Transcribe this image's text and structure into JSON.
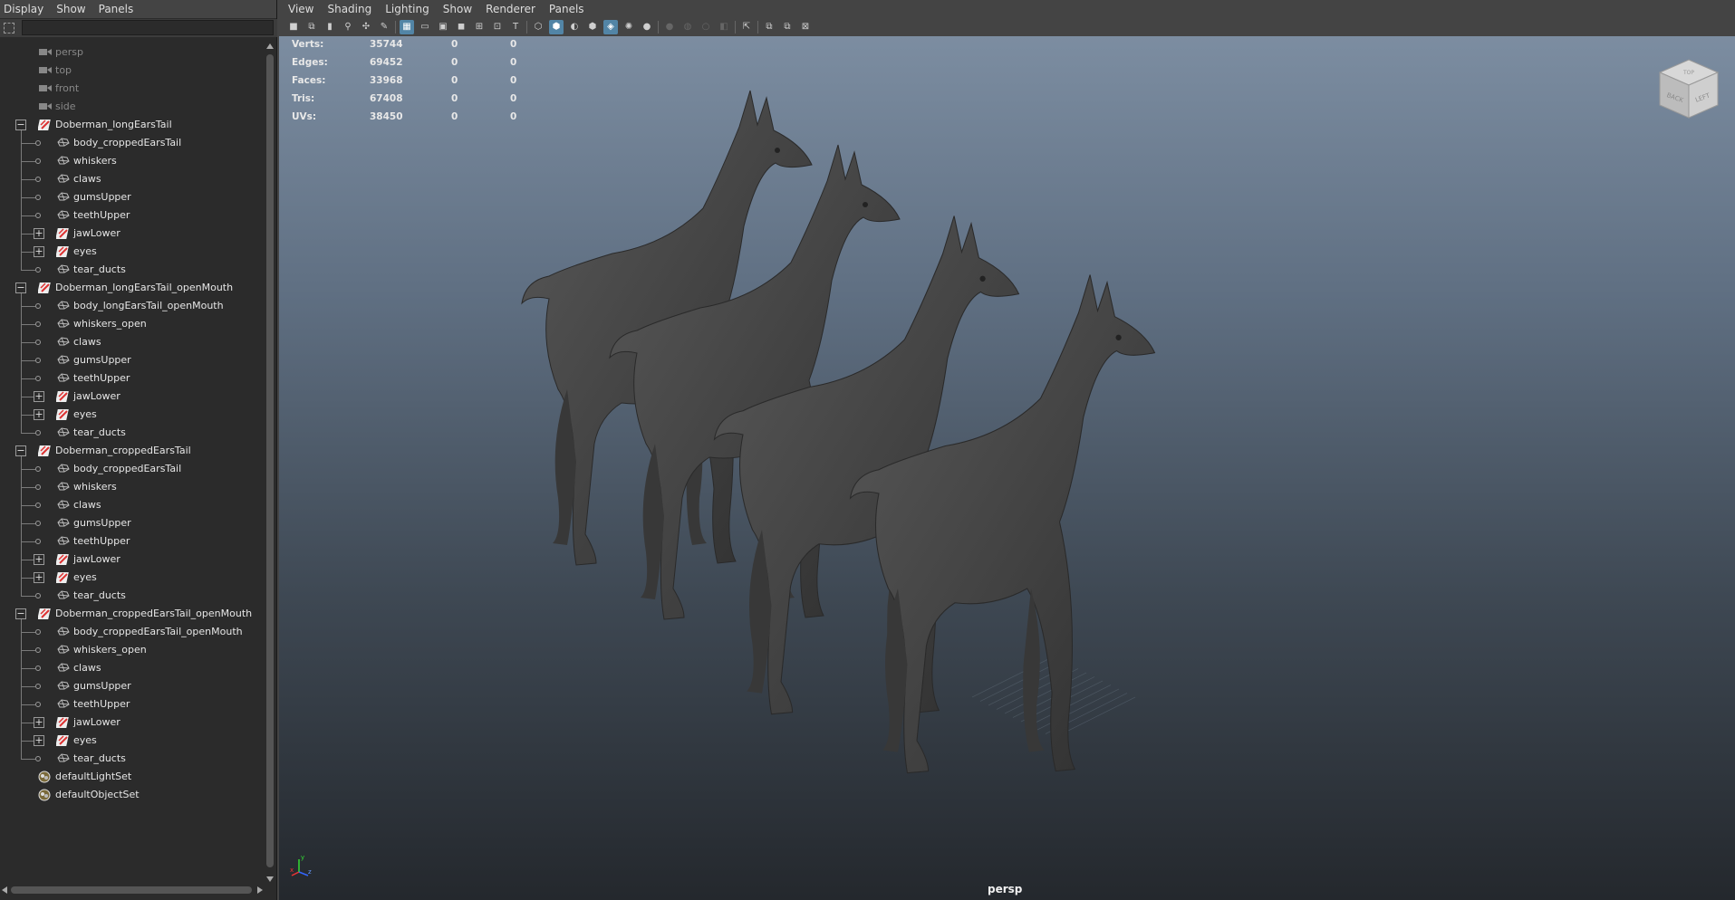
{
  "outliner": {
    "menu": [
      "Display",
      "Show",
      "Panels"
    ],
    "search_value": "",
    "items": [
      {
        "label": "persp",
        "depth": 0,
        "icon": "camera-icon",
        "toggle": "none",
        "dim": true
      },
      {
        "label": "top",
        "depth": 0,
        "icon": "camera-icon",
        "toggle": "none",
        "dim": true
      },
      {
        "label": "front",
        "depth": 0,
        "icon": "camera-icon",
        "toggle": "none",
        "dim": true
      },
      {
        "label": "side",
        "depth": 0,
        "icon": "camera-icon",
        "toggle": "none",
        "dim": true
      },
      {
        "label": "Doberman_longEarsTail",
        "depth": 0,
        "icon": "transform-icon",
        "toggle": "minus",
        "dim": false
      },
      {
        "label": "body_croppedEarsTail",
        "depth": 1,
        "icon": "mesh-icon",
        "toggle": "none",
        "dim": false
      },
      {
        "label": "whiskers",
        "depth": 1,
        "icon": "mesh-icon",
        "toggle": "none",
        "dim": false
      },
      {
        "label": "claws",
        "depth": 1,
        "icon": "mesh-icon",
        "toggle": "none",
        "dim": false
      },
      {
        "label": "gumsUpper",
        "depth": 1,
        "icon": "mesh-icon",
        "toggle": "none",
        "dim": false
      },
      {
        "label": "teethUpper",
        "depth": 1,
        "icon": "mesh-icon",
        "toggle": "none",
        "dim": false
      },
      {
        "label": "jawLower",
        "depth": 1,
        "icon": "transform-icon",
        "toggle": "plus",
        "dim": false
      },
      {
        "label": "eyes",
        "depth": 1,
        "icon": "transform-icon",
        "toggle": "plus",
        "dim": false
      },
      {
        "label": "tear_ducts",
        "depth": 1,
        "icon": "mesh-icon",
        "toggle": "none",
        "dim": false,
        "last": true
      },
      {
        "label": "Doberman_longEarsTail_openMouth",
        "depth": 0,
        "icon": "transform-icon",
        "toggle": "minus",
        "dim": false
      },
      {
        "label": "body_longEarsTail_openMouth",
        "depth": 1,
        "icon": "mesh-icon",
        "toggle": "none",
        "dim": false
      },
      {
        "label": "whiskers_open",
        "depth": 1,
        "icon": "mesh-icon",
        "toggle": "none",
        "dim": false
      },
      {
        "label": "claws",
        "depth": 1,
        "icon": "mesh-icon",
        "toggle": "none",
        "dim": false
      },
      {
        "label": "gumsUpper",
        "depth": 1,
        "icon": "mesh-icon",
        "toggle": "none",
        "dim": false
      },
      {
        "label": "teethUpper",
        "depth": 1,
        "icon": "mesh-icon",
        "toggle": "none",
        "dim": false
      },
      {
        "label": "jawLower",
        "depth": 1,
        "icon": "transform-icon",
        "toggle": "plus",
        "dim": false
      },
      {
        "label": "eyes",
        "depth": 1,
        "icon": "transform-icon",
        "toggle": "plus",
        "dim": false
      },
      {
        "label": "tear_ducts",
        "depth": 1,
        "icon": "mesh-icon",
        "toggle": "none",
        "dim": false,
        "last": true
      },
      {
        "label": "Doberman_croppedEarsTail",
        "depth": 0,
        "icon": "transform-icon",
        "toggle": "minus",
        "dim": false
      },
      {
        "label": "body_croppedEarsTail",
        "depth": 1,
        "icon": "mesh-icon",
        "toggle": "none",
        "dim": false
      },
      {
        "label": "whiskers",
        "depth": 1,
        "icon": "mesh-icon",
        "toggle": "none",
        "dim": false
      },
      {
        "label": "claws",
        "depth": 1,
        "icon": "mesh-icon",
        "toggle": "none",
        "dim": false
      },
      {
        "label": "gumsUpper",
        "depth": 1,
        "icon": "mesh-icon",
        "toggle": "none",
        "dim": false
      },
      {
        "label": "teethUpper",
        "depth": 1,
        "icon": "mesh-icon",
        "toggle": "none",
        "dim": false
      },
      {
        "label": "jawLower",
        "depth": 1,
        "icon": "transform-icon",
        "toggle": "plus",
        "dim": false
      },
      {
        "label": "eyes",
        "depth": 1,
        "icon": "transform-icon",
        "toggle": "plus",
        "dim": false
      },
      {
        "label": "tear_ducts",
        "depth": 1,
        "icon": "mesh-icon",
        "toggle": "none",
        "dim": false,
        "last": true
      },
      {
        "label": "Doberman_croppedEarsTail_openMouth",
        "depth": 0,
        "icon": "transform-icon",
        "toggle": "minus",
        "dim": false
      },
      {
        "label": "body_croppedEarsTail_openMouth",
        "depth": 1,
        "icon": "mesh-icon",
        "toggle": "none",
        "dim": false
      },
      {
        "label": "whiskers_open",
        "depth": 1,
        "icon": "mesh-icon",
        "toggle": "none",
        "dim": false
      },
      {
        "label": "claws",
        "depth": 1,
        "icon": "mesh-icon",
        "toggle": "none",
        "dim": false
      },
      {
        "label": "gumsUpper",
        "depth": 1,
        "icon": "mesh-icon",
        "toggle": "none",
        "dim": false
      },
      {
        "label": "teethUpper",
        "depth": 1,
        "icon": "mesh-icon",
        "toggle": "none",
        "dim": false
      },
      {
        "label": "jawLower",
        "depth": 1,
        "icon": "transform-icon",
        "toggle": "plus",
        "dim": false
      },
      {
        "label": "eyes",
        "depth": 1,
        "icon": "transform-icon",
        "toggle": "plus",
        "dim": false
      },
      {
        "label": "tear_ducts",
        "depth": 1,
        "icon": "mesh-icon",
        "toggle": "none",
        "dim": false,
        "last": true
      },
      {
        "label": "defaultLightSet",
        "depth": 0,
        "icon": "set-icon",
        "toggle": "none",
        "dim": false
      },
      {
        "label": "defaultObjectSet",
        "depth": 0,
        "icon": "set-icon",
        "toggle": "none",
        "dim": false
      }
    ]
  },
  "viewport": {
    "menu": [
      "View",
      "Shading",
      "Lighting",
      "Show",
      "Renderer",
      "Panels"
    ],
    "toolbar": [
      {
        "icon": "camera-select-icon",
        "state": "normal"
      },
      {
        "icon": "camera-lock-icon",
        "state": "normal"
      },
      {
        "icon": "bookmark-icon",
        "state": "normal"
      },
      {
        "icon": "image-plane-icon",
        "state": "normal"
      },
      {
        "icon": "camera-attributes-icon",
        "state": "normal"
      },
      {
        "icon": "grease-pencil-icon",
        "state": "normal"
      },
      {
        "icon": "sep",
        "state": "normal"
      },
      {
        "icon": "grid-icon",
        "state": "on"
      },
      {
        "icon": "film-gate-icon",
        "state": "normal"
      },
      {
        "icon": "resolution-gate-icon",
        "state": "normal"
      },
      {
        "icon": "gate-mask-icon",
        "state": "normal"
      },
      {
        "icon": "field-chart-icon",
        "state": "normal"
      },
      {
        "icon": "safe-action-icon",
        "state": "normal"
      },
      {
        "icon": "safe-title-icon",
        "state": "normal"
      },
      {
        "icon": "sep",
        "state": "normal"
      },
      {
        "icon": "wireframe-icon",
        "state": "normal"
      },
      {
        "icon": "smooth-shade-icon",
        "state": "on"
      },
      {
        "icon": "use-default-material-icon",
        "state": "normal"
      },
      {
        "icon": "wireframe-on-shaded-icon",
        "state": "normal"
      },
      {
        "icon": "xray-icon",
        "state": "on"
      },
      {
        "icon": "all-lights-icon",
        "state": "normal"
      },
      {
        "icon": "shadows-icon",
        "state": "normal"
      },
      {
        "icon": "sep",
        "state": "normal"
      },
      {
        "icon": "ambient-occlusion-icon",
        "state": "dim"
      },
      {
        "icon": "motion-blur-icon",
        "state": "dim"
      },
      {
        "icon": "multisample-icon",
        "state": "dim"
      },
      {
        "icon": "depth-of-field-icon",
        "state": "dim"
      },
      {
        "icon": "sep",
        "state": "normal"
      },
      {
        "icon": "isolate-select-icon",
        "state": "normal"
      },
      {
        "icon": "sep",
        "state": "normal"
      },
      {
        "icon": "xray-joints-icon",
        "state": "normal"
      },
      {
        "icon": "xray-active-components-icon",
        "state": "normal"
      },
      {
        "icon": "heads-up-display-icon",
        "state": "normal"
      }
    ],
    "hud": [
      {
        "label": "Verts:",
        "v1": "35744",
        "v2": "0",
        "v3": "0"
      },
      {
        "label": "Edges:",
        "v1": "69452",
        "v2": "0",
        "v3": "0"
      },
      {
        "label": "Faces:",
        "v1": "33968",
        "v2": "0",
        "v3": "0"
      },
      {
        "label": "Tris:",
        "v1": "67408",
        "v2": "0",
        "v3": "0"
      },
      {
        "label": "UVs:",
        "v1": "38450",
        "v2": "0",
        "v3": "0"
      }
    ],
    "camera_label": "persp",
    "viewcube_faces": [
      "BACK",
      "LEFT",
      "TOP"
    ],
    "axis_labels": [
      "x",
      "y",
      "z"
    ],
    "colors": {
      "bg_top": "#7c8da1",
      "bg_bottom": "#24282d",
      "model": "#4a4a4a",
      "selected": "#5285a6"
    }
  }
}
